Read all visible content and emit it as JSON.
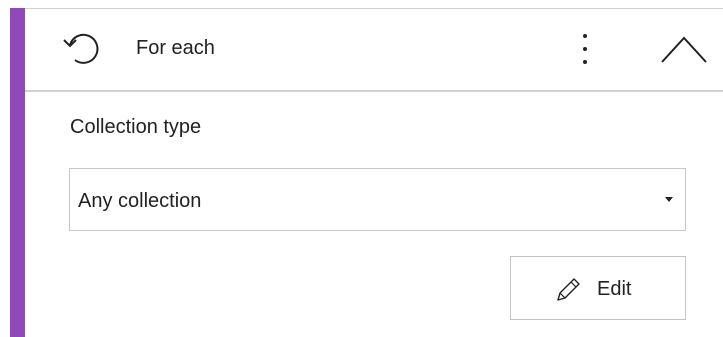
{
  "header": {
    "title": "For each",
    "icons": {
      "loop": "loop-arrow-icon",
      "more": "more-vertical-icon",
      "collapse": "chevron-up-icon"
    }
  },
  "form": {
    "collection_type_label": "Collection type",
    "collection_type_value": "Any collection",
    "collection_type_options_visible": [
      "Any collection"
    ]
  },
  "actions": {
    "edit_label": "Edit",
    "edit_icon": "pencil-icon"
  },
  "colors": {
    "accent": "#8f49b8",
    "border": "#c8c8c8",
    "text": "#222222"
  }
}
